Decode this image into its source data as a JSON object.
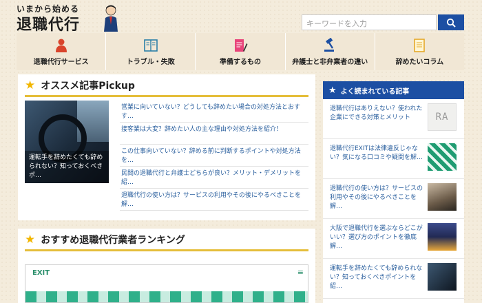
{
  "header": {
    "tagline": "いまから始める",
    "site_name": "退職代行",
    "search_placeholder": "キーワードを入力"
  },
  "nav": [
    {
      "label": "退職代行サービス",
      "icon": "person-icon"
    },
    {
      "label": "トラブル・失敗",
      "icon": "book-icon"
    },
    {
      "label": "準備するもの",
      "icon": "document-pen-icon"
    },
    {
      "label": "弁護士と非弁業者の違い",
      "icon": "gavel-icon"
    },
    {
      "label": "辞めたいコラム",
      "icon": "memo-icon"
    }
  ],
  "pickup": {
    "title": "オススメ記事Pickup",
    "featured_caption": "運転手を辞めたくても辞められない？知っておくべきポ…",
    "items": [
      "営業に向いていない？どうしても辞めたい場合の対処方法とおすす…",
      "接客業は大変？辞めたい人の主な理由や対処方法を紹介！",
      "この仕事向いていない？辞める前に判断するポイントや対処方法を…",
      "民間の退職代行と弁護士どちらが良い？メリット・デメリットを紹…",
      "退職代行の使い方は？サービスの利用やその後にやるべきことを解…"
    ]
  },
  "ranking": {
    "title": "おすすめ退職代行業者ランキング",
    "exit_logo": "EXIT"
  },
  "sidebar": {
    "title": "よく読まれている記事",
    "thumb0_text": "RA",
    "items": [
      "退職代行はありえない？使われた企業にできる対策とメリット",
      "退職代行EXITは法律違反じゃない？気になる口コミや疑問を解…",
      "退職代行の使い方は？サービスの利用やその後にやるべきことを解…",
      "大阪で退職代行を選ぶならどこがいい？選び方のポイントを徹底解…",
      "運転手を辞めたくても辞められない？知っておくべきポイントを紹…"
    ]
  },
  "colors": {
    "brand_blue": "#1c4fa3",
    "accent_yellow": "#e5be3a",
    "link_blue": "#2a5f9e"
  }
}
